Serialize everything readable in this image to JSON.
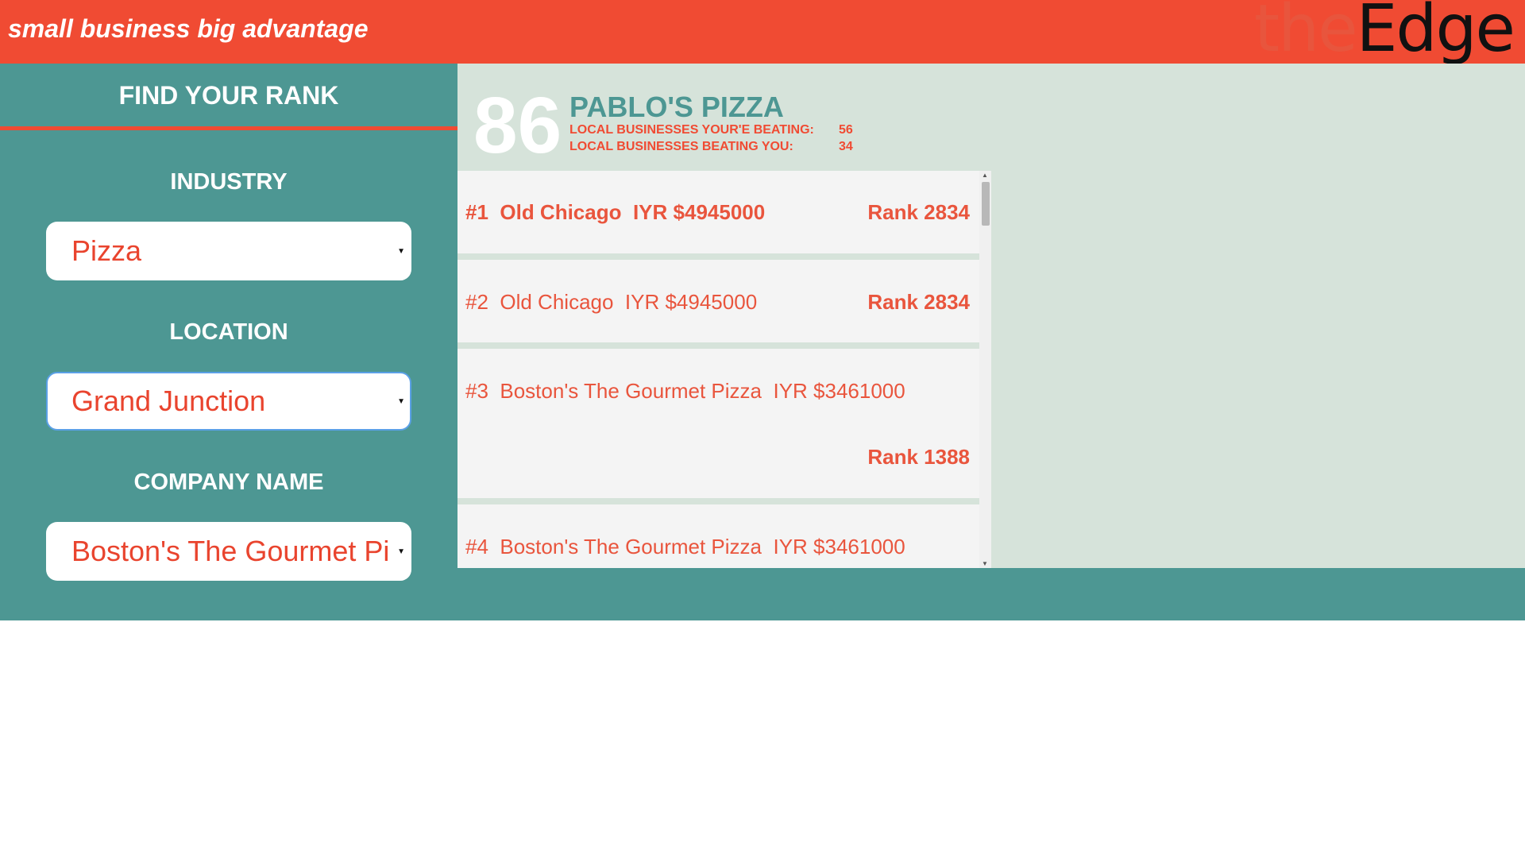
{
  "header": {
    "tagline": "small business big advantage",
    "logo_the": "the",
    "logo_edge": "Edge"
  },
  "sidebar": {
    "title": "FIND YOUR RANK",
    "industry_label": "INDUSTRY",
    "industry_value": "Pizza",
    "location_label": "LOCATION",
    "location_value": "Grand Junction",
    "company_label": "COMPANY NAME",
    "company_value": "Boston's The Gourmet Pizza"
  },
  "result": {
    "rank": "86",
    "business_name": "PABLO'S PIZZA",
    "beating_label": "LOCAL BUSINESSES YOUR'E BEATING:",
    "beating_value": "56",
    "beaten_label": "LOCAL BUSINESSES BEATING YOU:",
    "beaten_value": "34"
  },
  "list": {
    "rows": [
      {
        "num": "#1",
        "name": "Old Chicago",
        "iyr": "IYR $4945000",
        "rank": "Rank 2834"
      },
      {
        "num": "#2",
        "name": "Old Chicago",
        "iyr": "IYR $4945000",
        "rank": "Rank 2834"
      },
      {
        "num": "#3",
        "name": "Boston's The Gourmet Pizza",
        "iyr": "IYR $3461000",
        "rank": "Rank 1388"
      },
      {
        "num": "#4",
        "name": "Boston's The Gourmet Pizza",
        "iyr": "IYR $3461000",
        "rank": ""
      }
    ]
  },
  "colors": {
    "brand_red": "#f04b33",
    "teal": "#4d9793",
    "pale_green": "#d6e3da"
  }
}
